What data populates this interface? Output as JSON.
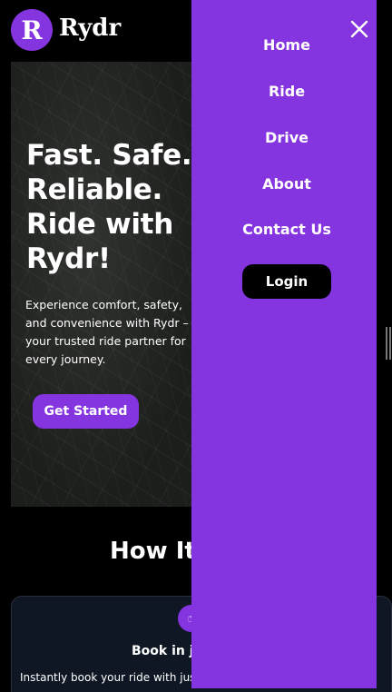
{
  "header": {
    "logo_letter": "R",
    "brand": "Rydr"
  },
  "hero": {
    "title": "Fast. Safe. Reliable. Ride with Rydr!",
    "description": "Experience comfort, safety, and convenience with Rydr – your trusted ride partner for every journey.",
    "cta_label": "Get Started"
  },
  "how_it_works": {
    "heading": "How It",
    "card": {
      "title": "Book in ju",
      "text": "Instantly book your ride with just"
    }
  },
  "menu": {
    "links": [
      "Home",
      "Ride",
      "Drive",
      "About",
      "Contact Us"
    ],
    "login_label": "Login",
    "close_icon": "close-icon"
  },
  "colors": {
    "accent": "#8535e0",
    "background": "#000000",
    "card": "#0f1624"
  }
}
